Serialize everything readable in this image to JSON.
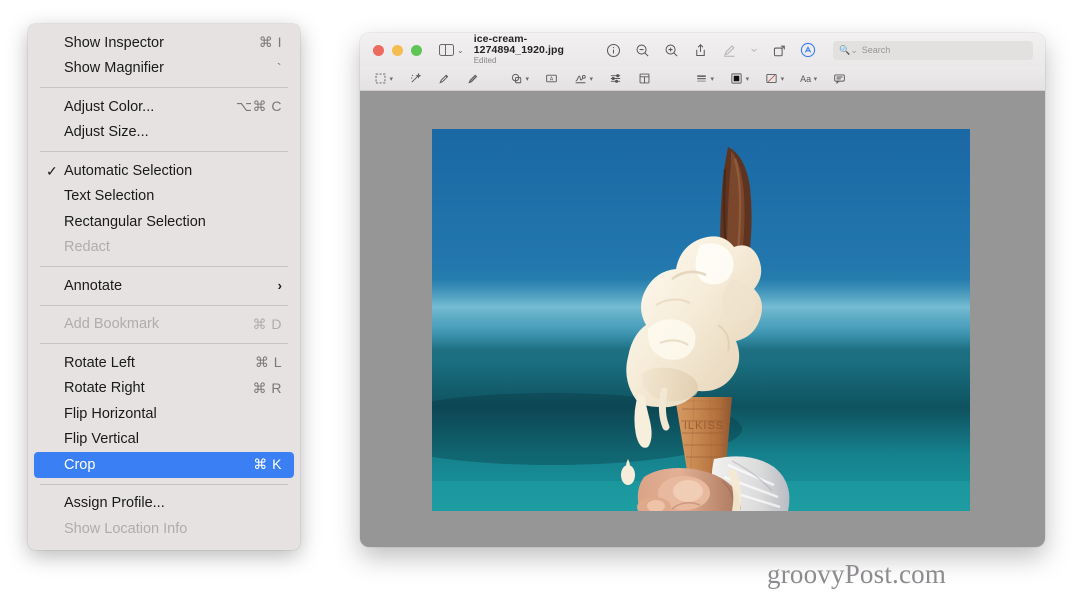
{
  "menu": {
    "items": [
      {
        "label": "Show Inspector",
        "shortcut": "⌘ I",
        "state": "normal",
        "kind": "item"
      },
      {
        "label": "Show Magnifier",
        "shortcut": "`",
        "state": "normal",
        "kind": "item"
      },
      {
        "kind": "separator"
      },
      {
        "label": "Adjust Color...",
        "shortcut": "⌥⌘ C",
        "state": "normal",
        "kind": "item"
      },
      {
        "label": "Adjust Size...",
        "shortcut": "",
        "state": "normal",
        "kind": "item"
      },
      {
        "kind": "separator"
      },
      {
        "label": "Automatic Selection",
        "shortcut": "",
        "state": "checked",
        "kind": "item",
        "check": "✓"
      },
      {
        "label": "Text Selection",
        "shortcut": "",
        "state": "normal",
        "kind": "item"
      },
      {
        "label": "Rectangular Selection",
        "shortcut": "",
        "state": "normal",
        "kind": "item"
      },
      {
        "label": "Redact",
        "shortcut": "",
        "state": "disabled",
        "kind": "item"
      },
      {
        "kind": "separator"
      },
      {
        "label": "Annotate",
        "shortcut": "",
        "state": "submenu",
        "kind": "item",
        "chevron": "›"
      },
      {
        "kind": "separator"
      },
      {
        "label": "Add Bookmark",
        "shortcut": "⌘ D",
        "state": "disabled",
        "kind": "item"
      },
      {
        "kind": "separator"
      },
      {
        "label": "Rotate Left",
        "shortcut": "⌘ L",
        "state": "normal",
        "kind": "item"
      },
      {
        "label": "Rotate Right",
        "shortcut": "⌘ R",
        "state": "normal",
        "kind": "item"
      },
      {
        "label": "Flip Horizontal",
        "shortcut": "",
        "state": "normal",
        "kind": "item"
      },
      {
        "label": "Flip Vertical",
        "shortcut": "",
        "state": "normal",
        "kind": "item"
      },
      {
        "label": "Crop",
        "shortcut": "⌘ K",
        "state": "selected",
        "kind": "item"
      },
      {
        "kind": "separator"
      },
      {
        "label": "Assign Profile...",
        "shortcut": "",
        "state": "normal",
        "kind": "item"
      },
      {
        "label": "Show Location Info",
        "shortcut": "",
        "state": "disabled",
        "kind": "item"
      }
    ],
    "highlight_color": "#3b7ff5",
    "background_color": "#e6e2e2"
  },
  "window": {
    "traffic_lights": [
      {
        "name": "close-button",
        "color": "#ec6a5f"
      },
      {
        "name": "minimize-button",
        "color": "#f4bd4f"
      },
      {
        "name": "zoom-button",
        "color": "#61c555"
      }
    ],
    "sidebar_toggle": {
      "icon": "sidebar-icon",
      "chevron": "⌄"
    },
    "document": {
      "filename": "ice-cream-1274894_1920.jpg",
      "status": "Edited"
    },
    "toolbar": [
      {
        "name": "info-button",
        "icon": "info-circle-icon",
        "state": "normal"
      },
      {
        "name": "zoom-out-button",
        "icon": "magnifier-minus-icon",
        "state": "normal"
      },
      {
        "name": "zoom-in-button",
        "icon": "magnifier-plus-icon",
        "state": "normal"
      },
      {
        "name": "share-button",
        "icon": "share-icon",
        "state": "normal"
      },
      {
        "name": "markup-button",
        "icon": "pen-icon",
        "state": "dim"
      },
      {
        "name": "markup-chevron",
        "icon": "chevron-down-icon",
        "state": "dim"
      },
      {
        "name": "rotate-button",
        "icon": "rotate-icon",
        "state": "normal"
      },
      {
        "name": "annotate-toggle",
        "icon": "annotate-circle-icon",
        "state": "active"
      }
    ],
    "search": {
      "placeholder": "Search",
      "value": "",
      "icon": "search-icon"
    },
    "markup_tools": [
      {
        "name": "selection-tool",
        "icon": "rect-selection-icon",
        "chevron": true
      },
      {
        "name": "instant-alpha-tool",
        "icon": "magic-wand-icon",
        "chevron": false
      },
      {
        "name": "sketch-tool",
        "icon": "sketch-icon",
        "chevron": false
      },
      {
        "name": "draw-tool",
        "icon": "draw-icon",
        "chevron": false
      },
      {
        "name": "shapes-tool",
        "icon": "shapes-icon",
        "chevron": true
      },
      {
        "name": "text-tool",
        "icon": "text-box-icon",
        "chevron": false
      },
      {
        "name": "sign-tool",
        "icon": "signature-icon",
        "chevron": true
      },
      {
        "name": "adjust-tool",
        "icon": "sliders-icon",
        "chevron": false
      },
      {
        "name": "crop-tool",
        "icon": "crop-icon",
        "chevron": false
      },
      {
        "name": "shape-style-tool",
        "icon": "shape-style-icon",
        "chevron": true
      },
      {
        "name": "border-color-tool",
        "icon": "border-color-icon",
        "chevron": true
      },
      {
        "name": "fill-color-tool",
        "icon": "fill-color-icon",
        "chevron": true
      },
      {
        "name": "text-style-tool",
        "icon": "text-style-icon",
        "label": "Aa",
        "chevron": true
      },
      {
        "name": "comment-tool",
        "icon": "comment-icon",
        "chevron": false
      }
    ],
    "canvas_background": "#969696"
  },
  "watermark": {
    "text": "groovyPost.com"
  }
}
